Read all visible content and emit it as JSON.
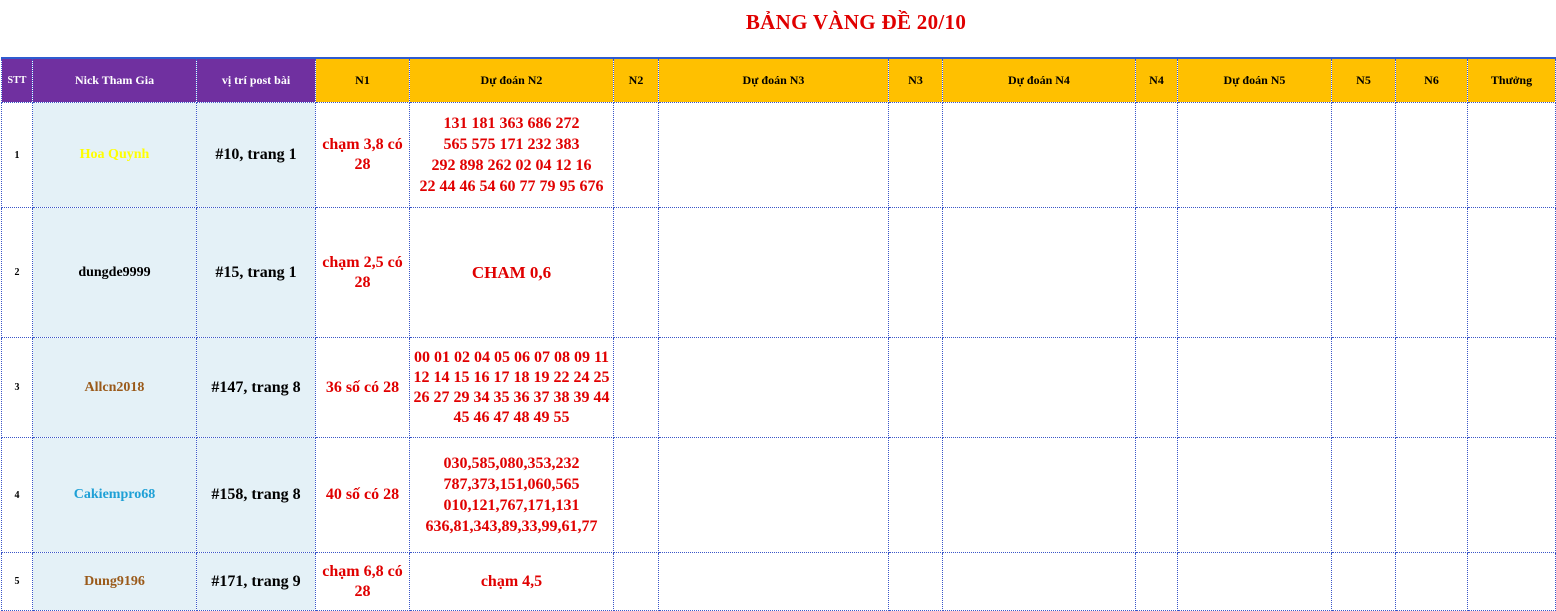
{
  "title": "BẢNG VÀNG ĐỀ 20/10",
  "columns": {
    "stt": "STT",
    "nick": "Nick Tham Gia",
    "position": "vị trí post bài",
    "n1": "N1",
    "pred_n2": "Dự đoán N2",
    "n2": "N2",
    "pred_n3": "Dự đoán N3",
    "n3": "N3",
    "pred_n4": "Dự đoán N4",
    "n4": "N4",
    "pred_n5": "Dự đoán N5",
    "n5": "N5",
    "n6": "N6",
    "reward": "Thưởng"
  },
  "colors": {
    "header_purple": "#7030a0",
    "header_gold": "#ffc000",
    "title_red": "#e00000",
    "cell_light_blue": "#e4f1f7"
  },
  "rows": [
    {
      "stt": "1",
      "nick": "Hoa Quynh",
      "nick_color": "#ffff00",
      "position": "#10, trang 1",
      "n1": "chạm 3,8 có 28",
      "pred_n2": [
        "131 181 363 686 272",
        "565 575 171 232 383",
        "292 898 262 02 04 12 16",
        "22 44 46 54 60 77 79 95 676"
      ]
    },
    {
      "stt": "2",
      "nick": "dungde9999",
      "nick_color": "#000000",
      "position": "#15, trang 1",
      "n1": "chạm 2,5 có 28",
      "pred_n2": [
        "CHAM 0,6"
      ]
    },
    {
      "stt": "3",
      "nick": "Allcn2018",
      "nick_color": "#9a5a1a",
      "position": "#147, trang 8",
      "n1": "36 số có 28",
      "pred_n2": [
        "00 01 02 04 05 06 07 08 09 11 12 14 15 16 17 18 19 22 24 25",
        "26 27 29 34 35 36 37 38 39 44 45 46 47 48 49 55"
      ]
    },
    {
      "stt": "4",
      "nick": "Cakiempro68",
      "nick_color": "#1ea0d6",
      "position": "#158, trang 8",
      "n1": "40 số có 28",
      "pred_n2": [
        "030,585,080,353,232",
        "787,373,151,060,565",
        "010,121,767,171,131",
        "636,81,343,89,33,99,61,77"
      ]
    },
    {
      "stt": "5",
      "nick": "Dung9196",
      "nick_color": "#9a5a1a",
      "position": "#171, trang  9",
      "n1": "chạm 6,8 có 28",
      "pred_n2": [
        "chạm 4,5"
      ]
    }
  ]
}
